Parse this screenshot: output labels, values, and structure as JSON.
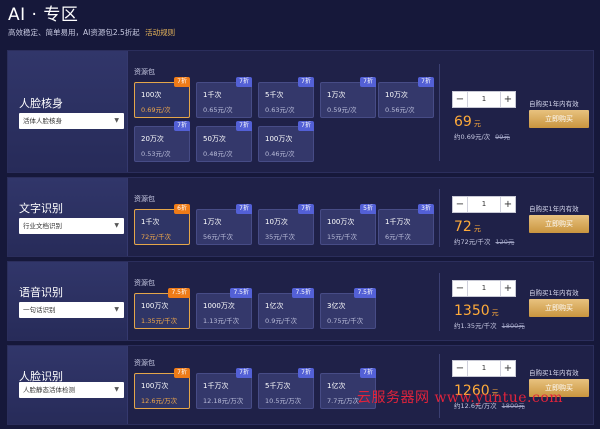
{
  "header": {
    "title": "AI · 专区",
    "subtitle": "高效稳定、简单易用，AI资源包2.5折起",
    "rules_link": "活动规则"
  },
  "sections": [
    {
      "title": "人脸核身",
      "select": "活体人脸核身",
      "pkg_label": "资源包",
      "packages": [
        {
          "count": "100次",
          "price": "0.69元/次",
          "discount": "7折",
          "selected": true
        },
        {
          "count": "1千次",
          "price": "0.65元/次",
          "discount": "7折"
        },
        {
          "count": "5千次",
          "price": "0.63元/次",
          "discount": "7折"
        },
        {
          "count": "1万次",
          "price": "0.59元/次",
          "discount": "7折"
        },
        {
          "count": "10万次",
          "price": "0.56元/次",
          "discount": "7折"
        },
        {
          "count": "20万次",
          "price": "0.53元/次",
          "discount": "7折"
        },
        {
          "count": "50万次",
          "price": "0.48元/次",
          "discount": "7折"
        },
        {
          "count": "100万次",
          "price": "0.46元/次",
          "discount": "7折"
        }
      ],
      "quantity": "1",
      "valid_note": "自购买1年内有效",
      "buy_label": "立即购买",
      "total": "69",
      "total_unit": "元",
      "unit_price": "约0.69元/次",
      "orig_price": "99元"
    },
    {
      "title": "文字识别",
      "select": "行业文档识别",
      "pkg_label": "资源包",
      "packages": [
        {
          "count": "1千次",
          "price": "72元/千次",
          "discount": "6折",
          "selected": true
        },
        {
          "count": "1万次",
          "price": "56元/千次",
          "discount": "7折"
        },
        {
          "count": "10万次",
          "price": "35元/千次",
          "discount": "7折"
        },
        {
          "count": "100万次",
          "price": "15元/千次",
          "discount": "5折"
        },
        {
          "count": "1千万次",
          "price": "6元/千次",
          "discount": "3折"
        }
      ],
      "quantity": "1",
      "valid_note": "自购买1年内有效",
      "buy_label": "立即购买",
      "total": "72",
      "total_unit": "元",
      "unit_price": "约72元/千次",
      "orig_price": "120元"
    },
    {
      "title": "语音识别",
      "select": "一句话识别",
      "pkg_label": "资源包",
      "packages": [
        {
          "count": "100万次",
          "price": "1.35元/千次",
          "discount": "7.5折",
          "selected": true
        },
        {
          "count": "1000万次",
          "price": "1.13元/千次",
          "discount": "7.5折"
        },
        {
          "count": "1亿次",
          "price": "0.9元/千次",
          "discount": "7.5折"
        },
        {
          "count": "3亿次",
          "price": "0.75元/千次",
          "discount": "7.5折"
        }
      ],
      "quantity": "1",
      "valid_note": "自购买1年内有效",
      "buy_label": "立即购买",
      "total": "1350",
      "total_unit": "元",
      "unit_price": "约1.35元/千次",
      "orig_price": "1800元"
    },
    {
      "title": "人脸识别",
      "select": "人脸静态活体检测",
      "pkg_label": "资源包",
      "packages": [
        {
          "count": "100万次",
          "price": "12.6元/万次",
          "discount": "7折",
          "selected": true
        },
        {
          "count": "1千万次",
          "price": "12.18元/万次",
          "discount": "7折"
        },
        {
          "count": "5千万次",
          "price": "10.5元/万次",
          "discount": "7折"
        },
        {
          "count": "1亿次",
          "price": "7.7元/万次",
          "discount": "7折"
        }
      ],
      "quantity": "1",
      "valid_note": "自购买1年内有效",
      "buy_label": "立即购买",
      "total": "1260",
      "total_unit": "元",
      "unit_price": "约12.6元/万次",
      "orig_price": "1800元"
    }
  ],
  "watermark": "云服务器网 www.yuntue.com",
  "colors": {
    "background": "#16183a",
    "accent_orange": "#ee7b18",
    "discount_badge": "#5360d6",
    "price": "#ffab3a",
    "buy_button": "#c9953f"
  }
}
